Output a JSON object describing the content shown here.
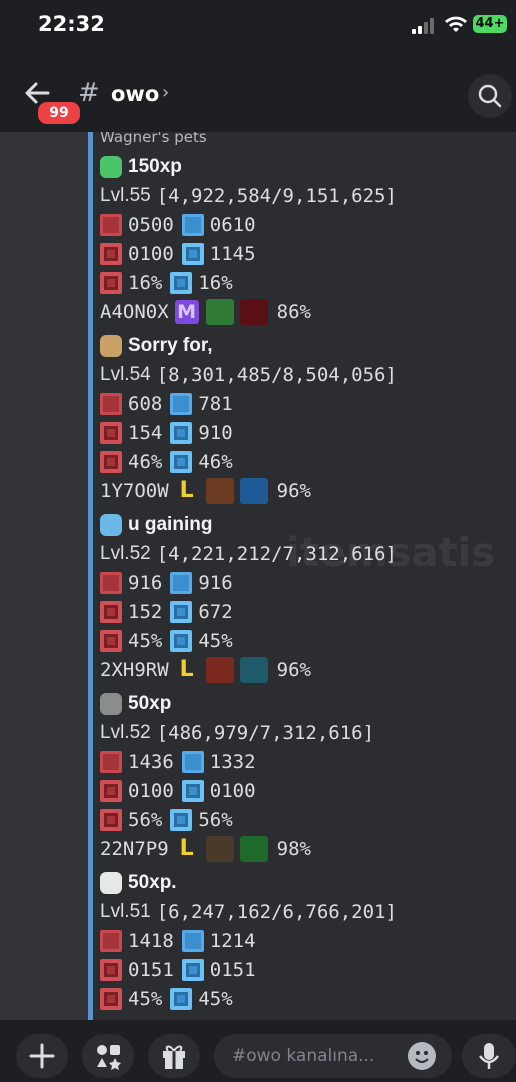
{
  "status_bar": {
    "time": "22:32",
    "battery": "44+"
  },
  "header": {
    "unread_badge": "99",
    "hash": "#",
    "channel_name": "owo",
    "chevron": "›"
  },
  "embed": {
    "partial_top": "Wagner's pets",
    "pets": [
      {
        "name": "150xp",
        "level": "Lvl.55",
        "xp": "[4,922,584/9,151,625]",
        "hp": "0500",
        "wp": "0610",
        "str": "0100",
        "mag": "1145",
        "pr": "16%",
        "mr": "16%",
        "id": "A4ON0X",
        "weapon_pct": "86%",
        "rank_badge": "M"
      },
      {
        "name": "Sorry for,",
        "level": "Lvl.54",
        "xp": "[8,301,485/8,504,056]",
        "hp": "608",
        "wp": "781",
        "str": "154",
        "mag": "910",
        "pr": "46%",
        "mr": "46%",
        "id": "1Y7O0W",
        "weapon_pct": "96%",
        "rank_badge": "L"
      },
      {
        "name": "u gaining",
        "level": "Lvl.52",
        "xp": "[4,221,212/7,312,616]",
        "hp": "916",
        "wp": "916",
        "str": "152",
        "mag": "672",
        "pr": "45%",
        "mr": "45%",
        "id": "2XH9RW",
        "weapon_pct": "96%",
        "rank_badge": "L"
      },
      {
        "name": "50xp",
        "level": "Lvl.52",
        "xp": "[486,979/7,312,616]",
        "hp": "1436",
        "wp": "1332",
        "str": "0100",
        "mag": "0100",
        "pr": "56%",
        "mr": "56%",
        "id": "22N7P9",
        "weapon_pct": "98%",
        "rank_badge": "L"
      },
      {
        "name": "50xp.",
        "level": "Lvl.51",
        "xp": "[6,247,162/6,766,201]",
        "hp": "1418",
        "wp": "1214",
        "str": "0151",
        "mag": "0151",
        "pr": "45%",
        "mr": "45%"
      }
    ],
    "watermark": "itemsatis"
  },
  "composer": {
    "placeholder": "#owo kanalına..."
  },
  "colors": {
    "embed_bar": "#5b92c7",
    "badge": "#ed4245",
    "hp_red": "#a4343a",
    "wp_blue": "#3c8fcf"
  }
}
